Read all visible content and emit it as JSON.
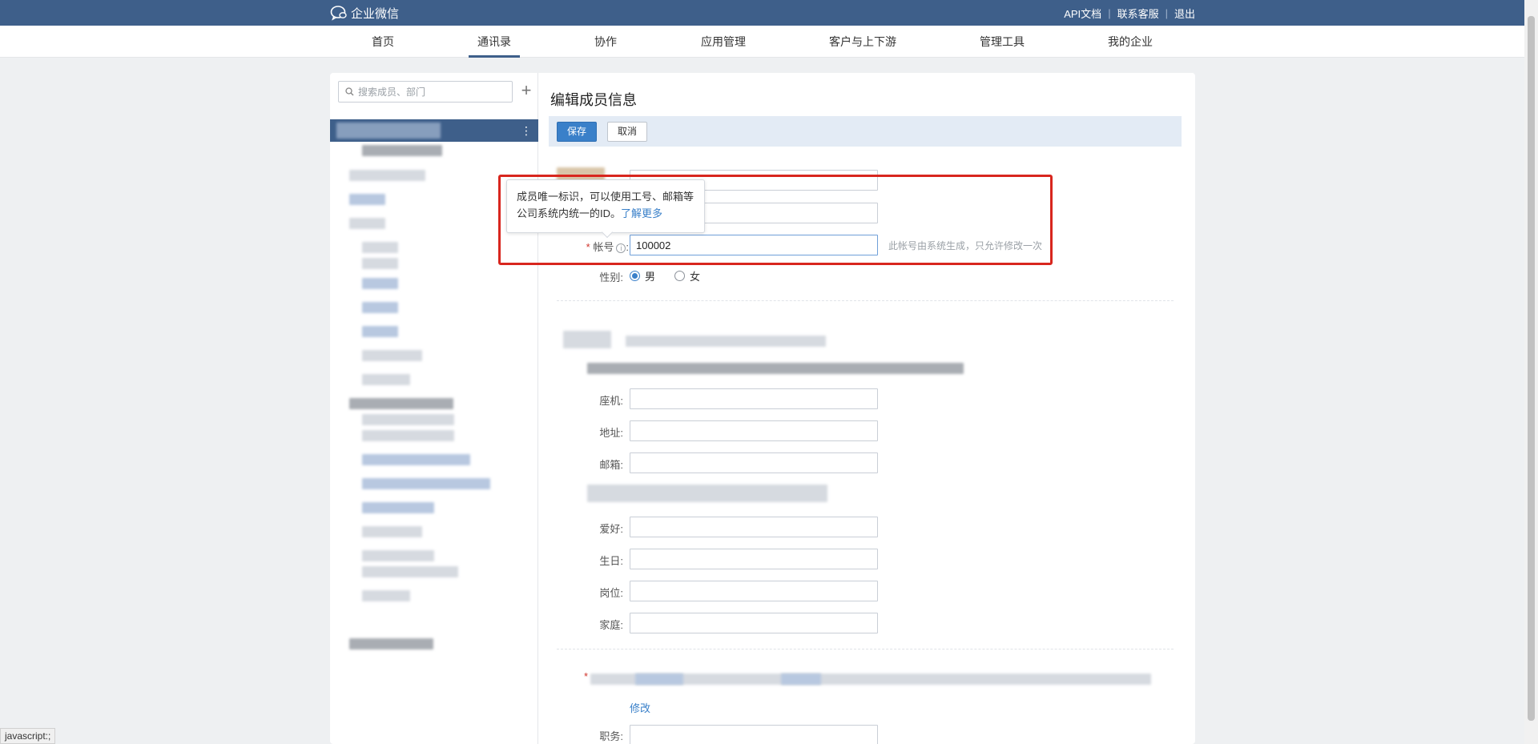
{
  "header": {
    "brand": "企业微信",
    "links": [
      "API文档",
      "联系客服",
      "退出"
    ]
  },
  "nav": {
    "items": [
      "首页",
      "通讯录",
      "协作",
      "应用管理",
      "客户与上下游",
      "管理工具",
      "我的企业"
    ],
    "active": "通讯录"
  },
  "sidebar": {
    "search_placeholder": "搜索成员、部门",
    "add_label": "+"
  },
  "form": {
    "title": "编辑成员信息",
    "save_label": "保存",
    "cancel_label": "取消",
    "account_label": "帐号",
    "account_value": "100002",
    "account_hint": "此帐号由系统生成，只允许修改一次",
    "gender_label": "性别:",
    "gender_male": "男",
    "gender_female": "女",
    "gender_selected": "男",
    "phone_label": "座机:",
    "address_label": "地址:",
    "email_label": "邮箱:",
    "hobby_label": "爱好:",
    "birthday_label": "生日:",
    "position_label": "岗位:",
    "family_label": "家庭:",
    "modify_label": "修改",
    "duty_label": "职务:"
  },
  "tooltip": {
    "line1": "成员唯一标识，可以使用工号、邮箱等",
    "line2": "公司系统内统一的ID。",
    "link": "了解更多"
  },
  "status": {
    "text": "javascript:;"
  },
  "colors": {
    "topbar": "#3e5f8a",
    "primary": "#3a80c9",
    "highlight": "#d8261e"
  }
}
